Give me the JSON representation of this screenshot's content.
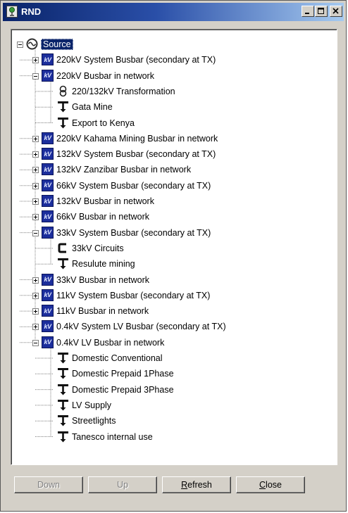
{
  "window": {
    "title": "RND"
  },
  "tree": [
    {
      "label": "Source",
      "level": 0,
      "icon": "source-icon",
      "expander": "minus",
      "selected": true
    },
    {
      "label": "220kV System Busbar (secondary at TX)",
      "level": 1,
      "icon": "kv-busbar-icon",
      "expander": "plus"
    },
    {
      "label": "220kV Busbar in network",
      "level": 1,
      "icon": "kv-busbar-icon",
      "expander": "minus"
    },
    {
      "label": "220/132kV Transformation",
      "level": 2,
      "icon": "transformer-icon"
    },
    {
      "label": "Gata Mine",
      "level": 2,
      "icon": "load-icon"
    },
    {
      "label": "Export to Kenya",
      "level": 2,
      "icon": "load-icon"
    },
    {
      "label": "220kV Kahama Mining Busbar in network",
      "level": 1,
      "icon": "kv-busbar-icon",
      "expander": "plus"
    },
    {
      "label": "132kV System Busbar (secondary at TX)",
      "level": 1,
      "icon": "kv-busbar-icon",
      "expander": "plus"
    },
    {
      "label": "132kV Zanzibar Busbar in network",
      "level": 1,
      "icon": "kv-busbar-icon",
      "expander": "plus"
    },
    {
      "label": "66kV System Busbar (secondary at TX)",
      "level": 1,
      "icon": "kv-busbar-icon",
      "expander": "plus"
    },
    {
      "label": "132kV Busbar in network",
      "level": 1,
      "icon": "kv-busbar-icon",
      "expander": "plus"
    },
    {
      "label": "66kV Busbar in network",
      "level": 1,
      "icon": "kv-busbar-icon",
      "expander": "plus"
    },
    {
      "label": "33kV System Busbar (secondary at TX)",
      "level": 1,
      "icon": "kv-busbar-icon",
      "expander": "minus"
    },
    {
      "label": "33kV Circuits",
      "level": 2,
      "icon": "circuit-icon"
    },
    {
      "label": "Resulute mining",
      "level": 2,
      "icon": "load-icon"
    },
    {
      "label": "33kV Busbar in network",
      "level": 1,
      "icon": "kv-busbar-icon",
      "expander": "plus"
    },
    {
      "label": "11kV System Busbar (secondary at TX)",
      "level": 1,
      "icon": "kv-busbar-icon",
      "expander": "plus"
    },
    {
      "label": "11kV Busbar in network",
      "level": 1,
      "icon": "kv-busbar-icon",
      "expander": "plus"
    },
    {
      "label": "0.4kV System LV Busbar (secondary at TX)",
      "level": 1,
      "icon": "kv-busbar-icon",
      "expander": "plus"
    },
    {
      "label": "0.4kV LV Busbar in network",
      "level": 1,
      "icon": "kv-busbar-icon",
      "expander": "minus"
    },
    {
      "label": "Domestic Conventional",
      "level": 2,
      "icon": "load-icon"
    },
    {
      "label": "Domestic Prepaid 1Phase",
      "level": 2,
      "icon": "load-icon"
    },
    {
      "label": "Domestic Prepaid 3Phase",
      "level": 2,
      "icon": "load-icon"
    },
    {
      "label": "LV Supply",
      "level": 2,
      "icon": "load-icon"
    },
    {
      "label": "Streetlights",
      "level": 2,
      "icon": "load-icon"
    },
    {
      "label": "Tanesco internal use",
      "level": 2,
      "icon": "load-icon"
    }
  ],
  "kv_icon_text": "kV",
  "buttons": {
    "down": "Down",
    "up": "Up",
    "refresh": "Refresh",
    "close": "Close"
  },
  "colors": {
    "titlebar": "#0a246a",
    "kv_icon": "#1c2e9c",
    "selection": "#0a246a"
  }
}
